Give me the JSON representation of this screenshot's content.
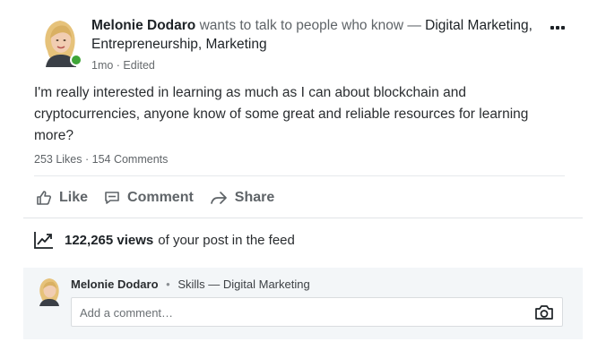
{
  "post": {
    "author_name": "Melonie Dodaro",
    "headline_connector": "wants to talk to people who know",
    "dash": "—",
    "topics": "Digital Marketing, Entrepreneurship, Marketing",
    "meta": "1mo · Edited",
    "body": "I'm really interested in learning as much as I can about blockchain and cryptocurrencies, anyone know of some great and reliable resources for learning more?",
    "counts": "253 Likes · 154 Comments"
  },
  "actions": {
    "like": "Like",
    "comment": "Comment",
    "share": "Share"
  },
  "views": {
    "count": "122,265 views",
    "suffix": "of your post in the feed"
  },
  "comment_box": {
    "commenter_name": "Melonie Dodaro",
    "bullet": "•",
    "skills": "Skills — Digital Marketing",
    "placeholder": "Add a comment…"
  },
  "colors": {
    "online": "#3fa537",
    "text": "#1d2226",
    "muted": "#5f6468",
    "comment_bg": "#f3f6f8"
  },
  "icons": [
    "more-icon",
    "thumbs-up-icon",
    "comment-icon",
    "share-arrow-icon",
    "trending-chart-icon",
    "camera-icon"
  ]
}
